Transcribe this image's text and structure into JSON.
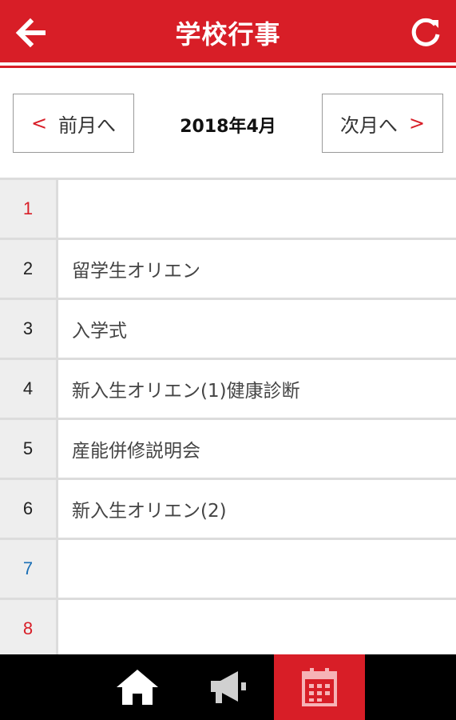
{
  "header": {
    "title": "学校行事",
    "back_icon": "back-arrow-icon",
    "refresh_icon": "refresh-icon",
    "accent_color": "#d81e27"
  },
  "month_nav": {
    "prev_label": "前月へ",
    "next_label": "次月へ",
    "current_month": "2018年4月",
    "prev_chevron": "<",
    "next_chevron": ">"
  },
  "days": [
    {
      "day": "1",
      "event": "",
      "color": "#d81e27"
    },
    {
      "day": "2",
      "event": "留学生オリエン",
      "color": "#222222"
    },
    {
      "day": "3",
      "event": "入学式",
      "color": "#222222"
    },
    {
      "day": "4",
      "event": "新入生オリエン(1)健康診断",
      "color": "#222222"
    },
    {
      "day": "5",
      "event": "産能併修説明会",
      "color": "#222222"
    },
    {
      "day": "6",
      "event": "新入生オリエン(2)",
      "color": "#222222"
    },
    {
      "day": "7",
      "event": "",
      "color": "#1a6fb5"
    },
    {
      "day": "8",
      "event": "",
      "color": "#d81e27"
    }
  ],
  "bottom_nav": {
    "items": [
      {
        "icon": "home-icon",
        "active": false
      },
      {
        "icon": "megaphone-icon",
        "active": false
      },
      {
        "icon": "calendar-icon",
        "active": true
      }
    ]
  }
}
